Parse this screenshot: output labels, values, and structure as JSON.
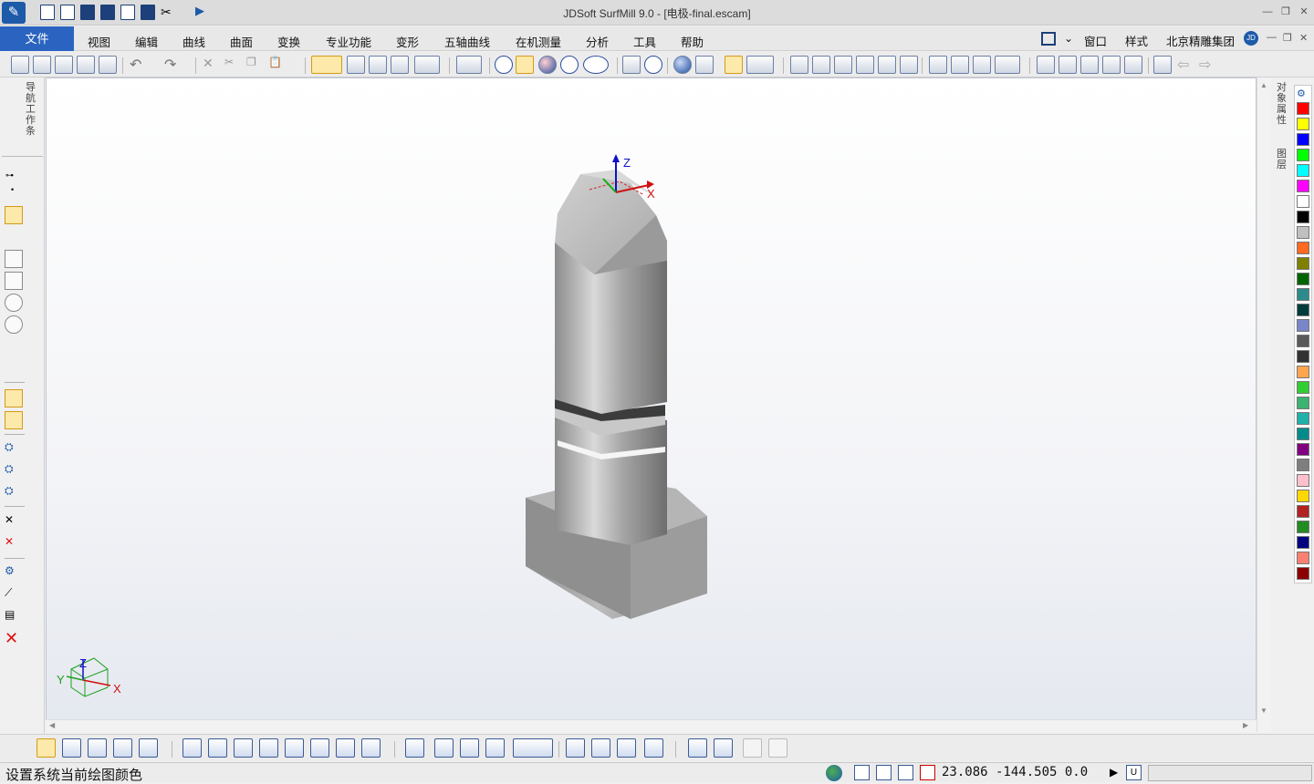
{
  "window": {
    "title": "JDSoft SurfMill 9.0 - [电极-final.escam]",
    "logo_icon": "surfmill-logo-icon",
    "controls": [
      "minimize-icon",
      "restore-icon",
      "close-icon"
    ]
  },
  "menu": {
    "file": "文件",
    "items": [
      "视图",
      "编辑",
      "曲线",
      "曲面",
      "变换",
      "专业功能",
      "变形",
      "五轴曲线",
      "在机测量",
      "分析",
      "工具",
      "帮助"
    ],
    "right": {
      "window": "窗口",
      "style": "样式",
      "company": "北京精雕集团",
      "user_badge": "JD"
    }
  },
  "left_panel": {
    "nav_tab": "导航工作条"
  },
  "right_panel": {
    "tab_properties": "对象属性",
    "tab_layers": "图层",
    "palette": [
      "#ff0000",
      "#ffff00",
      "#0000ff",
      "#00ff00",
      "#00ffff",
      "#ff00ff",
      "#ffffff",
      "#000000",
      "#c0c0c0",
      "#ff6a22",
      "#808000",
      "#006400",
      "#2e8b8b",
      "#003c3c",
      "#7b86c8",
      "#5a5a5a",
      "#323232",
      "#ffa54f",
      "#32cd32",
      "#3cb371",
      "#20b2aa",
      "#008b8b",
      "#800080",
      "#7f7f7f",
      "#ffc0cb",
      "#ffd700",
      "#b22222",
      "#228b22",
      "#000080",
      "#fa8072",
      "#8b0000"
    ]
  },
  "viewport": {
    "axis_top": {
      "z": "Z",
      "x": "X"
    },
    "axis_corner": {
      "z": "Z",
      "y": "Y",
      "x": "X"
    }
  },
  "status": {
    "message": "设置系统当前绘图颜色",
    "coords": "23.086 -144.505 0.0",
    "unit_badge": "U"
  }
}
